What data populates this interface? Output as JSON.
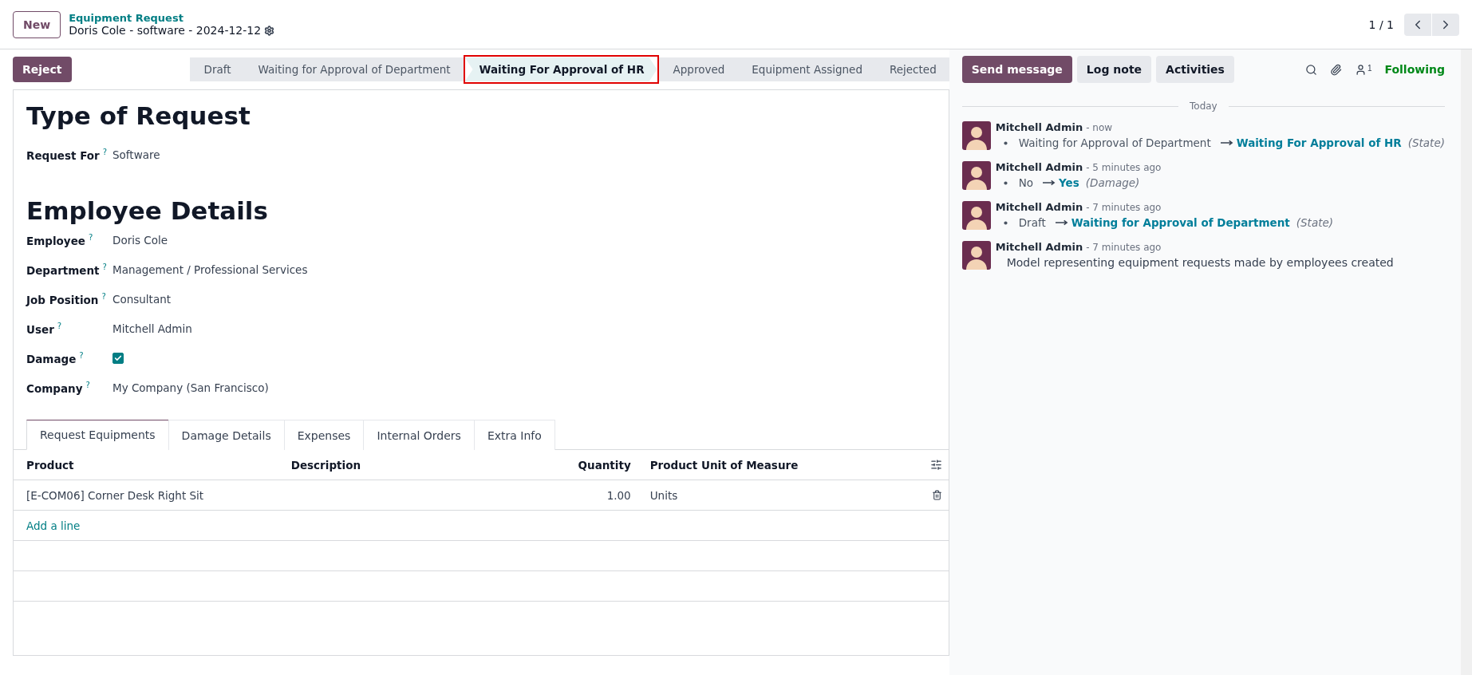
{
  "header": {
    "new_button": "New",
    "breadcrumb": "Equipment Request",
    "record_title": "Doris Cole - software - 2024-12-12",
    "pager": "1 / 1"
  },
  "actions": [
    {
      "label": "Reject"
    }
  ],
  "stages": [
    {
      "label": "Draft",
      "selected": false,
      "highlighted": false
    },
    {
      "label": "Waiting for Approval of Department",
      "selected": false,
      "highlighted": false
    },
    {
      "label": "Waiting For Approval of HR",
      "selected": true,
      "highlighted": true
    },
    {
      "label": "Approved",
      "selected": false,
      "highlighted": false
    },
    {
      "label": "Equipment Assigned",
      "selected": false,
      "highlighted": false
    },
    {
      "label": "Rejected",
      "selected": false,
      "highlighted": false
    }
  ],
  "form": {
    "title": "Type of Request",
    "request_fields": [
      {
        "label": "Request For",
        "help": "?",
        "kind": "text",
        "value": "Software"
      }
    ],
    "section_title": "Employee Details",
    "fields": [
      {
        "label": "Employee",
        "help": "?",
        "kind": "text",
        "value": "Doris Cole"
      },
      {
        "label": "Department",
        "help": "?",
        "kind": "text",
        "value": "Management / Professional Services"
      },
      {
        "label": "Job Position",
        "help": "?",
        "kind": "text",
        "value": "Consultant"
      },
      {
        "label": "User",
        "help": "?",
        "kind": "text",
        "value": "Mitchell Admin"
      },
      {
        "label": "Damage",
        "help": "?",
        "kind": "checkbox",
        "checked": true
      },
      {
        "label": "Company",
        "help": "?",
        "kind": "text",
        "value": "My Company (San Francisco)"
      }
    ],
    "tabs": [
      {
        "label": "Request Equipments",
        "selected": true
      },
      {
        "label": "Damage Details",
        "selected": false
      },
      {
        "label": "Expenses",
        "selected": false
      },
      {
        "label": "Internal Orders",
        "selected": false
      },
      {
        "label": "Extra Info",
        "selected": false
      }
    ],
    "table": {
      "columns": [
        "Product",
        "Description",
        "Quantity",
        "Product Unit of Measure"
      ],
      "rows": [
        {
          "product": "[E-COM06] Corner Desk Right Sit",
          "description": "",
          "quantity": "1.00",
          "uom": "Units"
        }
      ],
      "add_line": "Add a line"
    }
  },
  "chatter": {
    "buttons": [
      {
        "label": "Send message",
        "selected": true
      },
      {
        "label": "Log note",
        "selected": false
      },
      {
        "label": "Activities",
        "selected": false
      }
    ],
    "followers_count": "1",
    "follow_status": "Following",
    "date_separator": "Today",
    "messages": [
      {
        "author": "Mitchell Admin",
        "time": "- now",
        "kind": "tracking",
        "old": "Waiting for Approval of Department",
        "new": "Waiting For Approval of HR",
        "field": "(State)"
      },
      {
        "author": "Mitchell Admin",
        "time": "- 5 minutes ago",
        "kind": "tracking",
        "old": "No",
        "new": "Yes",
        "field": "(Damage)"
      },
      {
        "author": "Mitchell Admin",
        "time": "- 7 minutes ago",
        "kind": "tracking",
        "old": "Draft",
        "new": "Waiting for Approval of Department",
        "field": "(State)"
      },
      {
        "author": "Mitchell Admin",
        "time": "- 7 minutes ago",
        "kind": "note",
        "body": "Model representing equipment requests made by employees created"
      }
    ]
  }
}
